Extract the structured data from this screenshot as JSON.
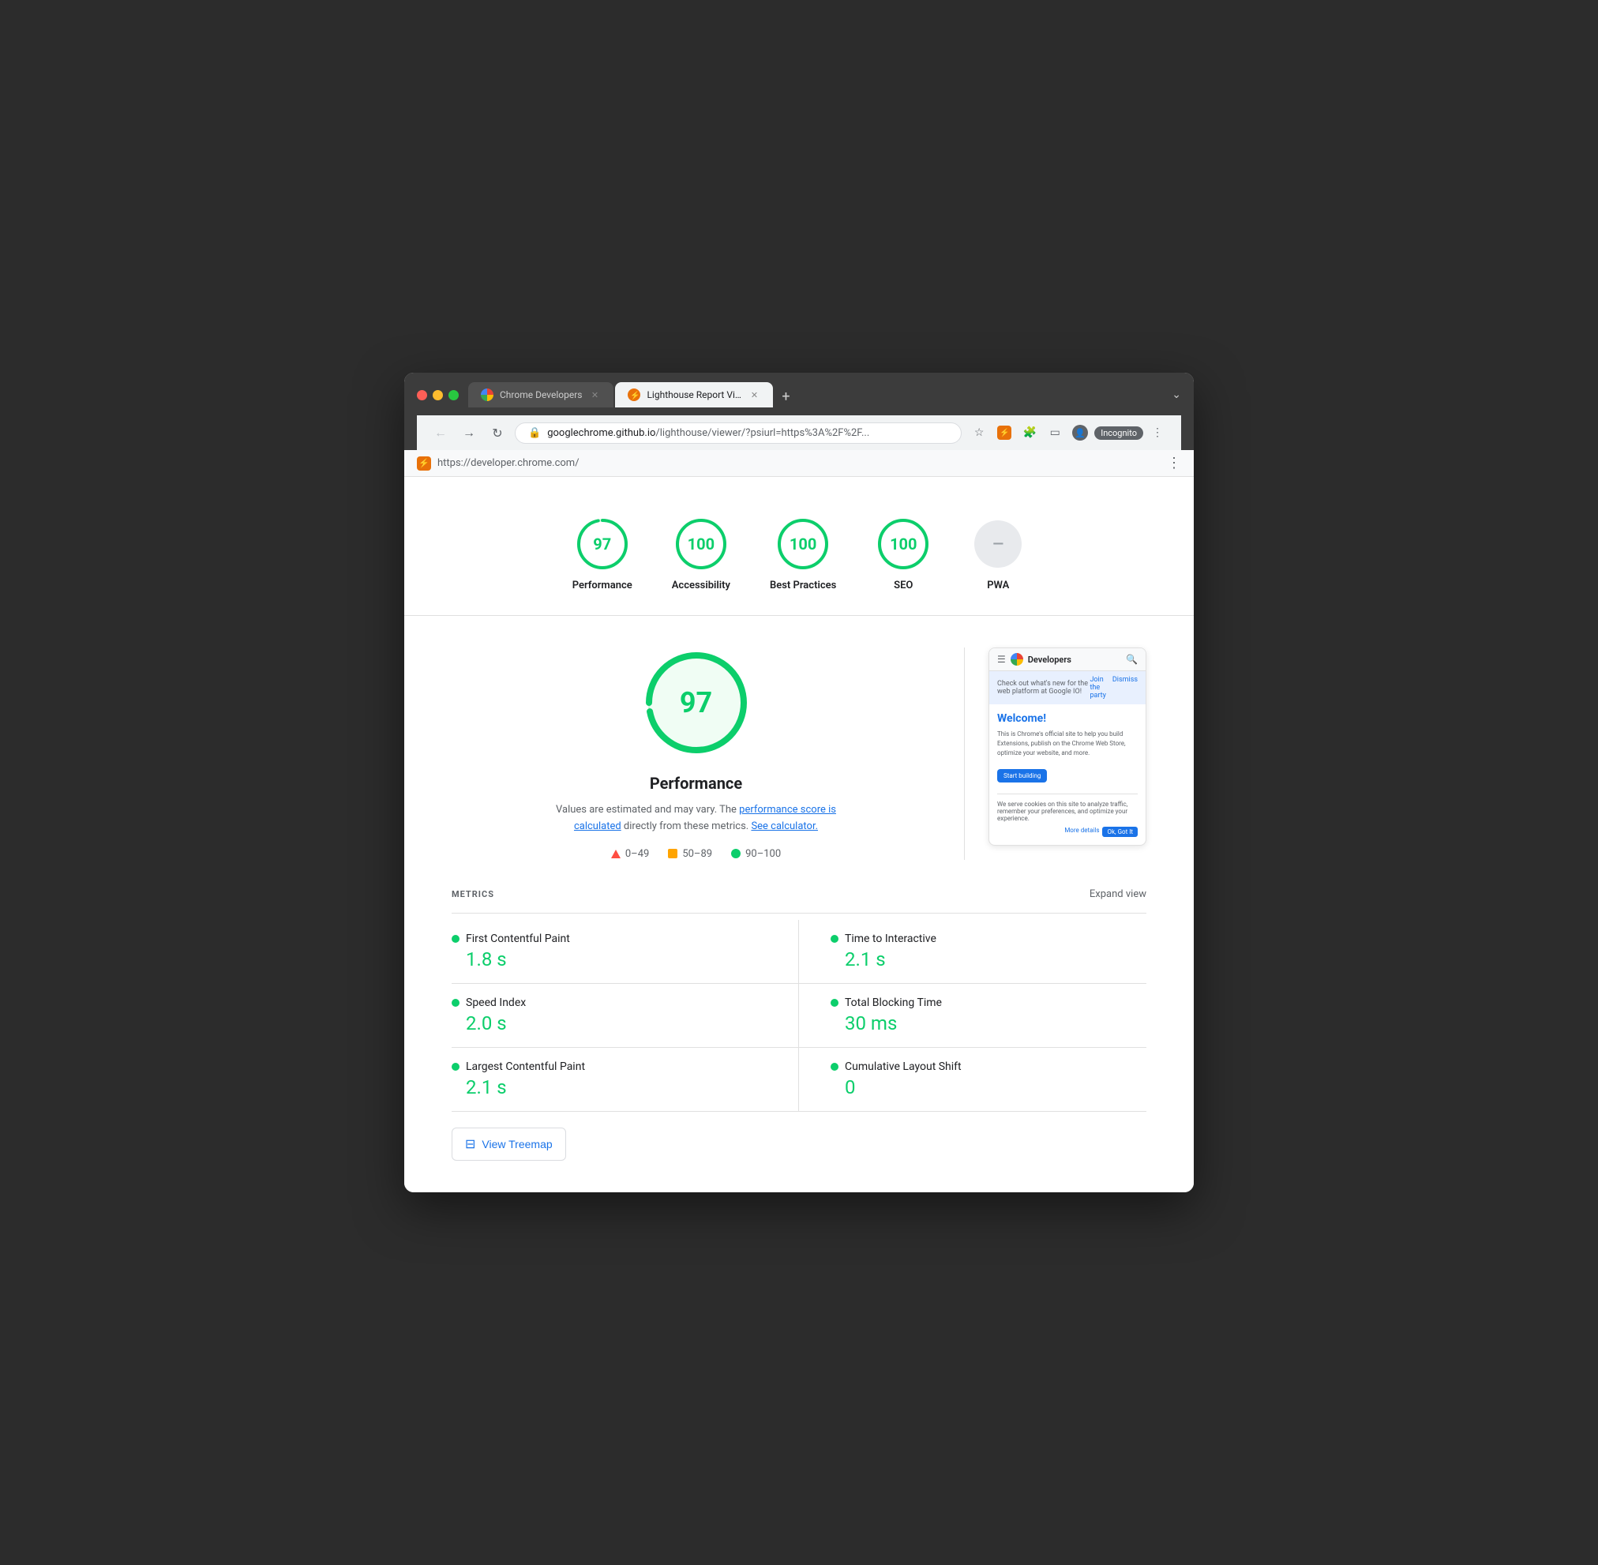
{
  "browser": {
    "tabs": [
      {
        "id": "chrome-developers",
        "title": "Chrome Developers",
        "icon_color": "#4285f4",
        "active": false
      },
      {
        "id": "lighthouse-viewer",
        "title": "Lighthouse Report Viewer",
        "icon_color": "#e8710a",
        "active": true
      }
    ],
    "address": {
      "domain": "googlechrome.github.io",
      "path": "/lighthouse/viewer/?psiurl=https%3A%2F%2F..."
    },
    "sub_bar": {
      "url": "https://developer.chrome.com/"
    },
    "incognito_label": "Incognito"
  },
  "scores": [
    {
      "id": "performance",
      "value": 97,
      "label": "Performance",
      "color": "#0cce6b",
      "pwa": false
    },
    {
      "id": "accessibility",
      "value": 100,
      "label": "Accessibility",
      "color": "#0cce6b",
      "pwa": false
    },
    {
      "id": "best-practices",
      "value": 100,
      "label": "Best Practices",
      "color": "#0cce6b",
      "pwa": false
    },
    {
      "id": "seo",
      "value": 100,
      "label": "SEO",
      "color": "#0cce6b",
      "pwa": false
    },
    {
      "id": "pwa",
      "value": "PWA",
      "label": "PWA",
      "color": "#9aa0a6",
      "pwa": true
    }
  ],
  "main": {
    "big_score": 97,
    "title": "Performance",
    "description_1": "Values are estimated and may vary. The ",
    "description_link_1": "performance score is calculated",
    "description_2": " directly from these metrics. ",
    "description_link_2": "See calculator.",
    "legend": [
      {
        "type": "triangle",
        "range": "0–49"
      },
      {
        "type": "square",
        "range": "50–89"
      },
      {
        "type": "circle",
        "range": "90–100"
      }
    ]
  },
  "screenshot": {
    "title": "Developers",
    "banner_text": "Check out what's new for the web platform at Google IO!",
    "join_label": "Join the party",
    "dismiss_label": "Dismiss",
    "welcome_text": "Welcome!",
    "body_text": "This is Chrome's official site to help you build Extensions, publish on the Chrome Web Store, optimize your website, and more.",
    "cta_label": "Start building",
    "cookie_text": "We serve cookies on this site to analyze traffic, remember your preferences, and optimize your experience.",
    "more_details_label": "More details",
    "ok_label": "Ok, Got It"
  },
  "metrics": {
    "section_title": "METRICS",
    "expand_label": "Expand view",
    "items": [
      {
        "id": "fcp",
        "name": "First Contentful Paint",
        "value": "1.8 s",
        "color": "#0cce6b"
      },
      {
        "id": "tti",
        "name": "Time to Interactive",
        "value": "2.1 s",
        "color": "#0cce6b"
      },
      {
        "id": "si",
        "name": "Speed Index",
        "value": "2.0 s",
        "color": "#0cce6b"
      },
      {
        "id": "tbt",
        "name": "Total Blocking Time",
        "value": "30 ms",
        "color": "#0cce6b"
      },
      {
        "id": "lcp",
        "name": "Largest Contentful Paint",
        "value": "2.1 s",
        "color": "#0cce6b"
      },
      {
        "id": "cls",
        "name": "Cumulative Layout Shift",
        "value": "0",
        "color": "#0cce6b"
      }
    ]
  },
  "treemap": {
    "label": "View Treemap"
  }
}
